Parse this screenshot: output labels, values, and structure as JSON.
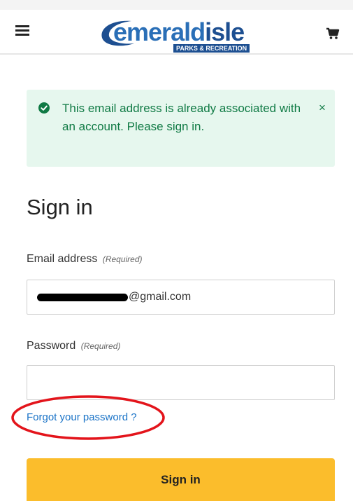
{
  "header": {
    "menu_icon": "hamburger-menu-icon",
    "logo": {
      "text_part1": "emerald",
      "text_part2": "isle",
      "subtitle": "PARKS & RECREATION"
    },
    "cart_icon": "shopping-cart-icon"
  },
  "alert": {
    "type": "success",
    "icon": "check-circle-icon",
    "message": "This email address is already associated with an account. Please sign in.",
    "close_label": "×"
  },
  "form": {
    "title": "Sign in",
    "email": {
      "label": "Email address",
      "required_text": "(Required)",
      "value_visible": "@gmail.com"
    },
    "password": {
      "label": "Password",
      "required_text": "(Required)",
      "value": ""
    },
    "forgot_link": "Forgot your password ?",
    "submit_label": "Sign in"
  },
  "colors": {
    "alert_bg": "#e6f7ee",
    "alert_text": "#0f7a44",
    "link": "#1a73c7",
    "button_bg": "#fbbd2c",
    "highlight": "#e3141b",
    "logo_blue": "#2a6fb7",
    "logo_dark_blue": "#1d4f91"
  }
}
